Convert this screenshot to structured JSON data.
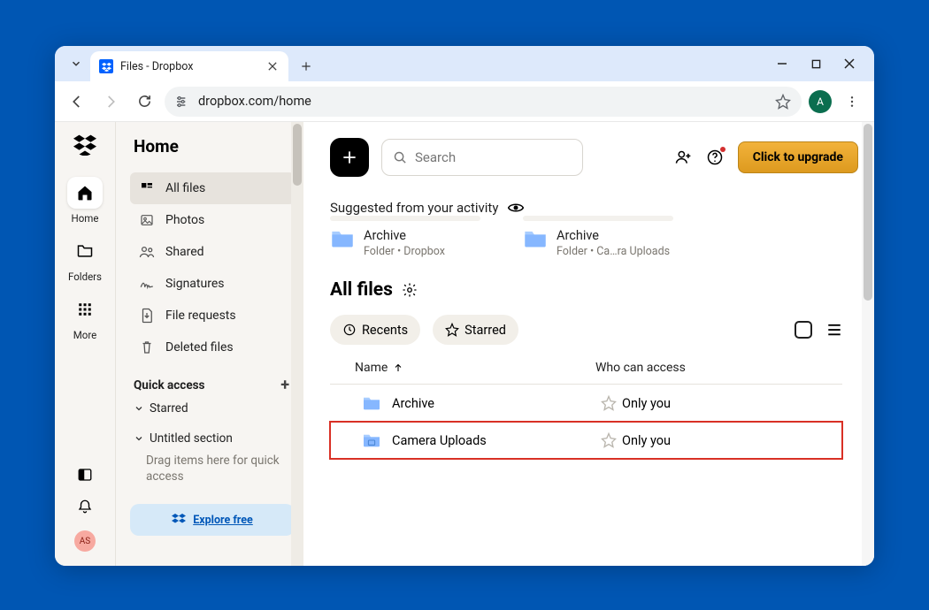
{
  "browser": {
    "tab_title": "Files - Dropbox",
    "url": "dropbox.com/home",
    "profile_initial": "A"
  },
  "rail": {
    "items": [
      {
        "label": "Home"
      },
      {
        "label": "Folders"
      },
      {
        "label": "More"
      }
    ],
    "bottom_badge": "AS"
  },
  "sidebar": {
    "heading": "Home",
    "items": [
      {
        "label": "All files"
      },
      {
        "label": "Photos"
      },
      {
        "label": "Shared"
      },
      {
        "label": "Signatures"
      },
      {
        "label": "File requests"
      },
      {
        "label": "Deleted files"
      }
    ],
    "quick_access_label": "Quick access",
    "starred_label": "Starred",
    "untitled_label": "Untitled section",
    "hint": "Drag items here for quick access",
    "explore": "Explore free"
  },
  "main": {
    "search_placeholder": "Search",
    "upgrade_label": "Click to upgrade",
    "suggested_label": "Suggested from your activity",
    "suggestions": [
      {
        "title": "Archive",
        "subtitle": "Folder • Dropbox"
      },
      {
        "title": "Archive",
        "subtitle": "Folder • Ca…ra Uploads"
      }
    ],
    "all_files_heading": "All files",
    "chips": {
      "recents": "Recents",
      "starred": "Starred"
    },
    "columns": {
      "name": "Name",
      "access": "Who can access"
    },
    "rows": [
      {
        "name": "Archive",
        "access": "Only you"
      },
      {
        "name": "Camera Uploads",
        "access": "Only you"
      }
    ]
  }
}
